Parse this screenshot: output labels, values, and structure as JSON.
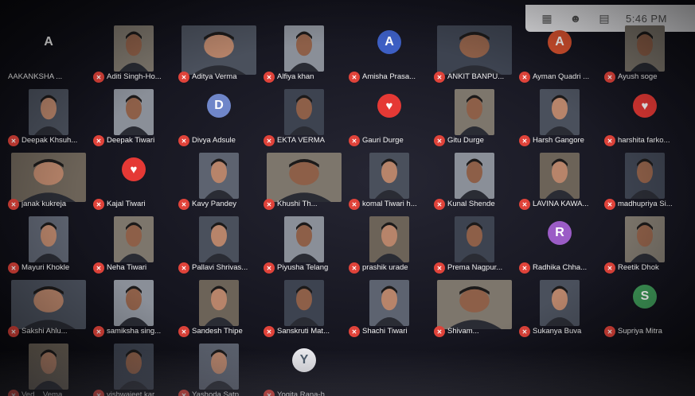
{
  "status_bar": {
    "time": "5:46 PM"
  },
  "colors": {
    "avatar_blue": "#3d5fc4",
    "avatar_orange": "#d9522f",
    "avatar_gray": "#6f86c9",
    "avatar_purple": "#9b5cc6",
    "avatar_green": "#3f9a59",
    "avatar_pink": "#c4577f",
    "muted_red": "#e0433a"
  },
  "participants": [
    {
      "name": "AAKANKSHA ...",
      "kind": "letter",
      "letter": "A",
      "color": "transparent",
      "muted": false
    },
    {
      "name": "Aditi Singh-Ho...",
      "kind": "video",
      "muted": true
    },
    {
      "name": "Aditya Verma",
      "kind": "video-wide",
      "muted": true
    },
    {
      "name": "Alfiya khan",
      "kind": "video",
      "muted": true
    },
    {
      "name": "Amisha Prasa...",
      "kind": "letter",
      "letter": "A",
      "color": "#3d5fc4",
      "muted": true
    },
    {
      "name": "ANKIT BANPU...",
      "kind": "video-wide",
      "muted": true
    },
    {
      "name": "Ayman Quadri ...",
      "kind": "letter",
      "letter": "A",
      "color": "#d9522f",
      "muted": true
    },
    {
      "name": "Ayush soge",
      "kind": "video",
      "muted": true
    },
    {
      "name": "Deepak Khsuh...",
      "kind": "video",
      "muted": true
    },
    {
      "name": "Deepak Tiwari",
      "kind": "video",
      "muted": true
    },
    {
      "name": "Divya Adsule",
      "kind": "letter",
      "letter": "D",
      "color": "#6f86c9",
      "muted": true
    },
    {
      "name": "EKTA VERMA",
      "kind": "video",
      "muted": true
    },
    {
      "name": "Gauri Durge",
      "kind": "heart",
      "muted": true
    },
    {
      "name": "Gitu Durge",
      "kind": "video",
      "muted": true
    },
    {
      "name": "Harsh Gangore",
      "kind": "video",
      "muted": true
    },
    {
      "name": "harshita farko...",
      "kind": "heart",
      "muted": true
    },
    {
      "name": "janak kukreja",
      "kind": "video-wide",
      "muted": true
    },
    {
      "name": "Kajal Tiwari",
      "kind": "heart",
      "muted": true
    },
    {
      "name": "Kavy Pandey",
      "kind": "video",
      "muted": true
    },
    {
      "name": "Khushi Th...",
      "kind": "video-wide",
      "muted": true
    },
    {
      "name": "komal Tiwari h...",
      "kind": "video",
      "muted": true
    },
    {
      "name": "Kunal Shende",
      "kind": "video",
      "muted": true
    },
    {
      "name": "LAVINA KAWA...",
      "kind": "video",
      "muted": true
    },
    {
      "name": "madhupriya Si...",
      "kind": "video",
      "muted": true
    },
    {
      "name": "Mayuri Khokle",
      "kind": "video",
      "muted": true
    },
    {
      "name": "Neha Tiwari",
      "kind": "video",
      "muted": true
    },
    {
      "name": "Pallavi Shrivas...",
      "kind": "video",
      "muted": true
    },
    {
      "name": "Piyusha Telang",
      "kind": "video",
      "muted": true
    },
    {
      "name": "prashik urade",
      "kind": "video",
      "muted": true
    },
    {
      "name": "Prema Nagpur...",
      "kind": "video",
      "muted": true
    },
    {
      "name": "Radhika Chha...",
      "kind": "letter",
      "letter": "R",
      "color": "#9b5cc6",
      "muted": true
    },
    {
      "name": "Reetik Dhok",
      "kind": "video",
      "muted": true
    },
    {
      "name": "Sakshi Ahlu...",
      "kind": "video-wide",
      "muted": true
    },
    {
      "name": "samiksha sing...",
      "kind": "video",
      "muted": true
    },
    {
      "name": "Sandesh Thipe",
      "kind": "video",
      "muted": true
    },
    {
      "name": "Sanskruti Mat...",
      "kind": "video",
      "muted": true
    },
    {
      "name": "Shachi Tiwari",
      "kind": "video",
      "muted": true
    },
    {
      "name": "Shivam...",
      "kind": "video-wide",
      "muted": true
    },
    {
      "name": "Sukanya Buva",
      "kind": "video",
      "muted": true
    },
    {
      "name": "Supriya Mitra",
      "kind": "letter",
      "letter": "S",
      "color": "#3f9a59",
      "muted": true
    },
    {
      "name": "Ved... Vema...",
      "kind": "video",
      "muted": true
    },
    {
      "name": "vishwajeet kar...",
      "kind": "video",
      "muted": true
    },
    {
      "name": "Yashoda Satp...",
      "kind": "video",
      "muted": true
    },
    {
      "name": "Yogita Rana-h...",
      "kind": "letter",
      "letter": "Y",
      "color": "#e8e8ec",
      "muted": true
    }
  ]
}
